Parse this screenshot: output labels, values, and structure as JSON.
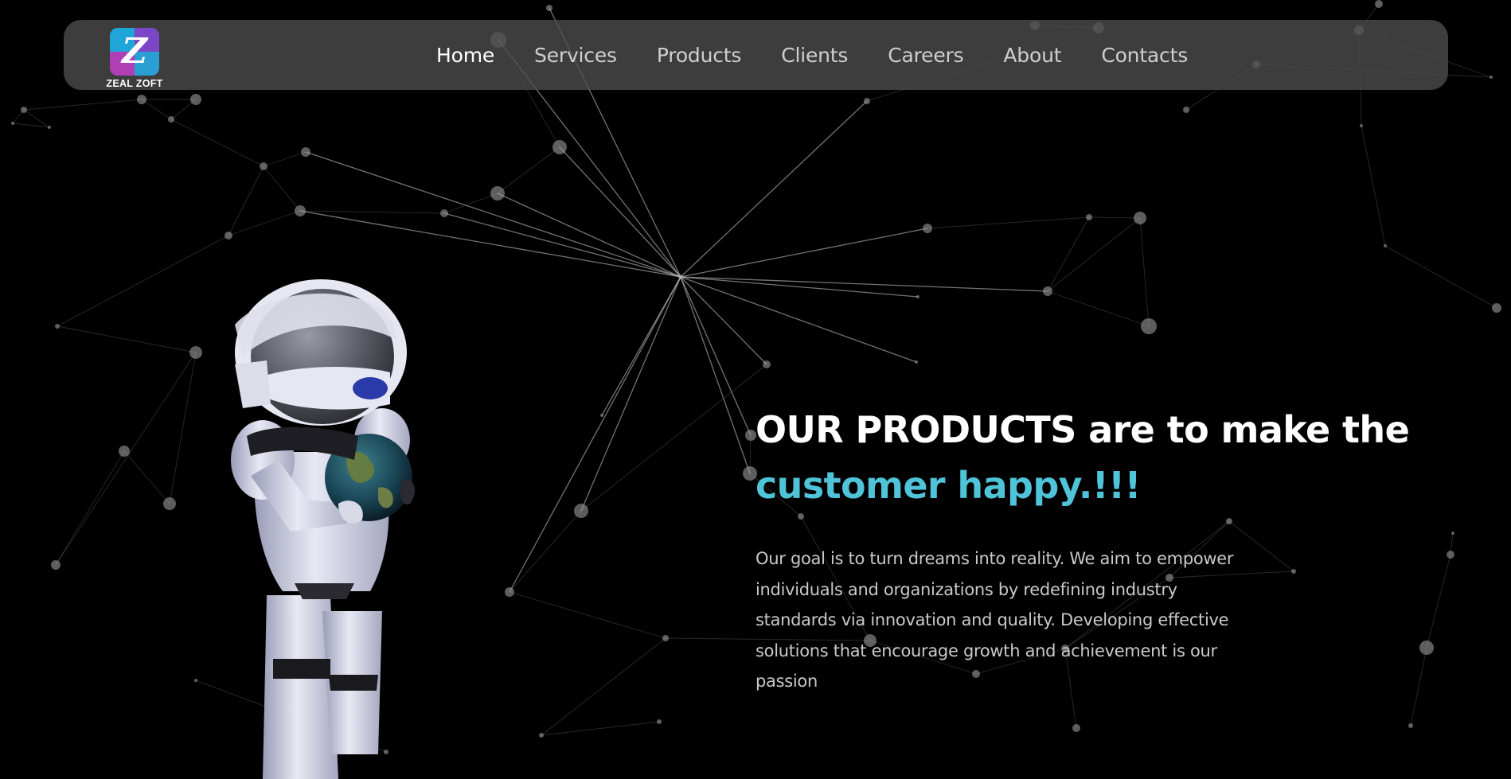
{
  "brand": {
    "name": "ZEAL ZOFT",
    "logo_letter": "Z"
  },
  "nav": {
    "items": [
      {
        "label": "Home",
        "active": true
      },
      {
        "label": "Services"
      },
      {
        "label": "Products"
      },
      {
        "label": "Clients"
      },
      {
        "label": "Careers"
      },
      {
        "label": "About"
      },
      {
        "label": "Contacts"
      }
    ]
  },
  "hero": {
    "headline_white": "OUR PRODUCTS are to make the",
    "headline_accent": "customer happy.!!!",
    "description": "Our goal is to turn dreams into reality. We aim to empower individuals and organizations by redefining industry standards via innovation and quality. Developing effective solutions that encourage growth and achievement is our passion"
  },
  "colors": {
    "accent": "#4fc3d8",
    "background": "#000000",
    "navbar": "#4e4e4e"
  }
}
